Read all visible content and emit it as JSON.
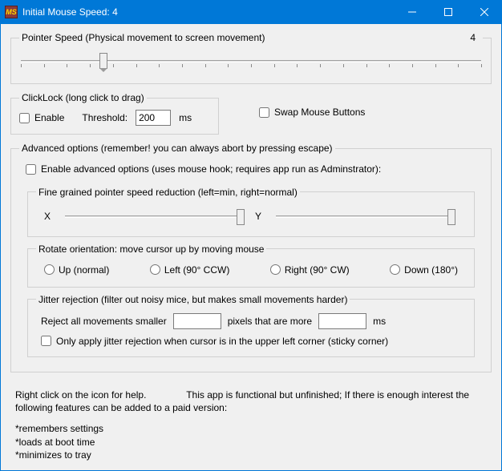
{
  "window": {
    "title": "Initial Mouse Speed: 4",
    "icon_text": "MS"
  },
  "pointer": {
    "legend": "Pointer Speed (Physical movement to screen movement)",
    "value": "4",
    "slider_pos_percent": 18
  },
  "clicklock": {
    "legend": "ClickLock (long click to drag)",
    "enable_label": "Enable",
    "threshold_label": "Threshold:",
    "threshold_value": "200",
    "threshold_unit": "ms"
  },
  "swap": {
    "label": "Swap Mouse Buttons"
  },
  "advanced": {
    "legend": "Advanced options  (remember! you can always abort by pressing escape)",
    "enable_label": "Enable advanced options (uses mouse hook; requires app run as Adminstrator):",
    "fine": {
      "legend": "Fine grained pointer speed reduction   (left=min, right=normal)",
      "x_label": "X",
      "y_label": "Y",
      "x_pos_percent": 100,
      "y_pos_percent": 100
    },
    "rotate": {
      "legend": "Rotate orientation: move cursor up by moving mouse",
      "up": "Up (normal)",
      "left": "Left (90° CCW)",
      "right": "Right (90° CW)",
      "down": "Down (180°)"
    },
    "jitter": {
      "legend": "Jitter rejection    (filter out noisy mice, but makes small movements harder)",
      "line_a": "Reject all movements smaller",
      "line_b": "pixels that are more",
      "unit": "ms",
      "px_value": "",
      "ms_value": "",
      "sticky_label": "Only apply jitter rejection when cursor is in the upper left corner (sticky corner)"
    }
  },
  "footer": {
    "para1": "Right click on the icon for help.               This app is functional but unfinished; If there is enough interest the following features can be added to a paid version:",
    "bullet1": "*remembers settings",
    "bullet2": "*loads at boot time",
    "bullet3": "*minimizes to tray"
  }
}
